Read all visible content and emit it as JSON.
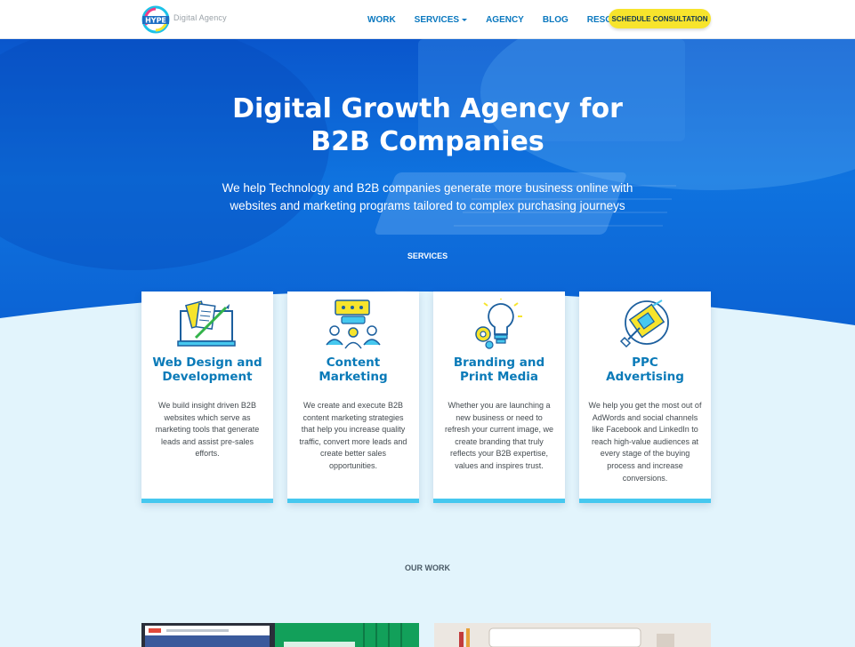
{
  "header": {
    "logo_text": "HYPE",
    "logo_sub": "Digital Agency",
    "nav": [
      {
        "label": "WORK",
        "has_caret": false
      },
      {
        "label": "SERVICES",
        "has_caret": true
      },
      {
        "label": "AGENCY",
        "has_caret": false
      },
      {
        "label": "BLOG",
        "has_caret": false
      },
      {
        "label": "RESOURCES",
        "has_caret": false
      }
    ],
    "cta_label": "SCHEDULE CONSULTATION"
  },
  "hero": {
    "title_line1": "Digital Growth Agency for",
    "title_line2": "B2B Companies",
    "subtitle_line1": "We help Technology and B2B companies generate more business online with",
    "subtitle_line2": "websites and marketing programs tailored to complex purchasing journeys",
    "section_label": "SERVICES"
  },
  "services": [
    {
      "icon": "web-design-icon",
      "title_line1": "Web Design and",
      "title_line2": "Development",
      "text": "We build insight driven B2B websites which serve as marketing tools that generate leads and assist pre-sales efforts."
    },
    {
      "icon": "content-marketing-icon",
      "title_line1": "Content",
      "title_line2": "Marketing",
      "text": "We create and execute B2B content marketing strategies that help you increase quality traffic, convert more leads and create better sales opportunities."
    },
    {
      "icon": "branding-icon",
      "title_line1": "Branding and",
      "title_line2": "Print Media",
      "text": "Whether you are launching a new business or need to refresh your current image, we create branding that truly reflects your B2B expertise, values and inspires trust."
    },
    {
      "icon": "ppc-advertising-icon",
      "title_line1": "PPC",
      "title_line2": "Advertising",
      "text": "We help you get the most out of AdWords and social channels like Facebook and LinkedIn to reach high-value audiences at every stage of the buying process and increase conversions."
    }
  ],
  "work_label": "OUR WORK",
  "colors": {
    "brand_blue": "#0a78bf",
    "hero_blue": "#0f73df",
    "cta_yellow": "#f7e42c",
    "card_accent": "#46c8ef",
    "page_bg": "#e2f4fc"
  }
}
